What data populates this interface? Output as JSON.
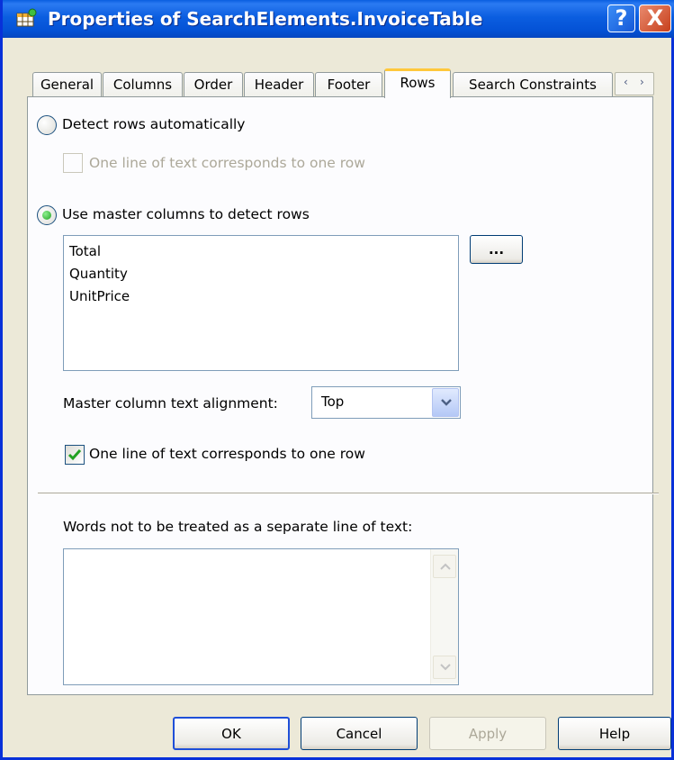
{
  "window": {
    "title": "Properties of SearchElements.InvoiceTable",
    "help_glyph": "?",
    "close_glyph": "X"
  },
  "tabs": [
    {
      "label": "General"
    },
    {
      "label": "Columns"
    },
    {
      "label": "Order"
    },
    {
      "label": "Header"
    },
    {
      "label": "Footer"
    },
    {
      "label": "Rows",
      "active": true
    },
    {
      "label": "Search Constraints"
    }
  ],
  "tab_scroll": {
    "left": "‹",
    "right": "›"
  },
  "rows": {
    "detect_auto": {
      "label": "Detect rows automatically",
      "selected": false
    },
    "auto_one_line": {
      "label": "One line of text corresponds to one row",
      "checked": false,
      "enabled": false
    },
    "use_master": {
      "label": "Use master columns to detect rows",
      "selected": true
    },
    "master_columns": [
      "Total",
      "Quantity",
      "UnitPrice"
    ],
    "browse_button": "...",
    "alignment_label": "Master column text alignment:",
    "alignment_value": "Top",
    "master_one_line": {
      "label": "One line of text corresponds to one row",
      "checked": true,
      "enabled": true
    },
    "words_label": "Words not to be treated as a separate line of text:",
    "words_value": ""
  },
  "buttons": {
    "ok": "OK",
    "cancel": "Cancel",
    "apply": "Apply",
    "help": "Help"
  }
}
